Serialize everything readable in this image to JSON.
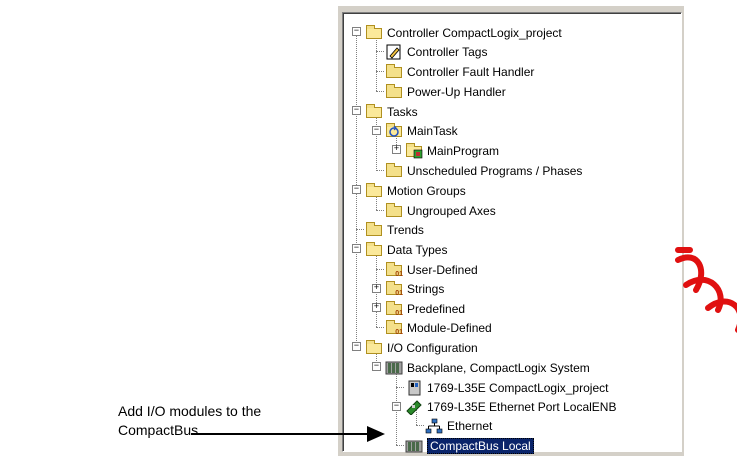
{
  "tree": {
    "items": [
      {
        "label": "Controller CompactLogix_project",
        "icon": "folder-open-icon"
      },
      {
        "label": "Controller Tags",
        "icon": "tags-icon"
      },
      {
        "label": "Controller Fault Handler",
        "icon": "folder-icon"
      },
      {
        "label": "Power-Up Handler",
        "icon": "folder-icon"
      },
      {
        "label": "Tasks",
        "icon": "folder-open-icon"
      },
      {
        "label": "MainTask",
        "icon": "task-icon"
      },
      {
        "label": "MainProgram",
        "icon": "program-icon"
      },
      {
        "label": "Unscheduled Programs / Phases",
        "icon": "folder-icon"
      },
      {
        "label": "Motion Groups",
        "icon": "folder-open-icon"
      },
      {
        "label": "Ungrouped Axes",
        "icon": "folder-icon"
      },
      {
        "label": "Trends",
        "icon": "folder-icon"
      },
      {
        "label": "Data Types",
        "icon": "folder-open-icon"
      },
      {
        "label": "User-Defined",
        "icon": "datatype-folder-icon"
      },
      {
        "label": "Strings",
        "icon": "datatype-folder-icon"
      },
      {
        "label": "Predefined",
        "icon": "datatype-folder-icon"
      },
      {
        "label": "Module-Defined",
        "icon": "datatype-folder-icon"
      },
      {
        "label": "I/O Configuration",
        "icon": "folder-open-icon"
      },
      {
        "label": "Backplane, CompactLogix System",
        "icon": "backplane-icon"
      },
      {
        "label": "1769-L35E CompactLogix_project",
        "icon": "controller-module-icon"
      },
      {
        "label": "1769-L35E Ethernet Port LocalENB",
        "icon": "ethernet-port-icon"
      },
      {
        "label": "Ethernet",
        "icon": "network-icon"
      },
      {
        "label": "CompactBus Local",
        "icon": "compactbus-icon"
      }
    ]
  },
  "callout": {
    "text_line1": "Add I/O modules to the",
    "text_line2": "CompactBus."
  }
}
